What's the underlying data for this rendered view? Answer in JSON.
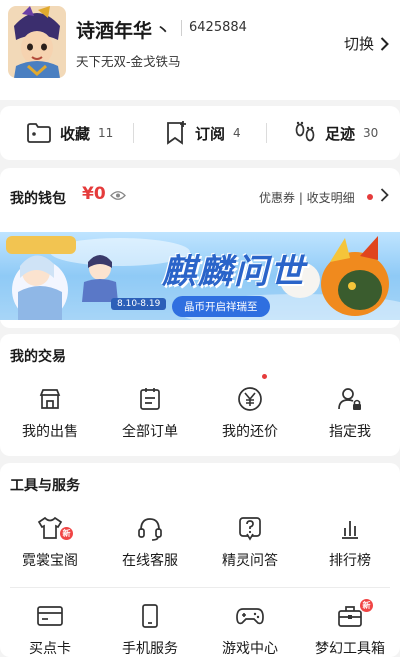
{
  "profile": {
    "nickname": "诗酒年华",
    "nick_suffix": "丶",
    "uid": "6425884",
    "server": "天下无双-金戈铁马",
    "switch_label": "切换"
  },
  "stats": [
    {
      "label": "收藏",
      "count": "11",
      "icon": "folder-icon"
    },
    {
      "label": "订阅",
      "count": "4",
      "icon": "bookmark-add-icon"
    },
    {
      "label": "足迹",
      "count": "30",
      "icon": "footprints-icon"
    }
  ],
  "wallet": {
    "title": "我的钱包",
    "balance": "¥0",
    "links": "优惠券 | 收支明细",
    "banner": {
      "title": "麒麟问世",
      "date_range": "8.10-8.19",
      "subtitle": "晶币开启祥瑞至"
    }
  },
  "trade": {
    "title": "我的交易",
    "items": [
      {
        "label": "我的出售",
        "icon": "shop-icon"
      },
      {
        "label": "全部订单",
        "icon": "order-list-icon"
      },
      {
        "label": "我的还价",
        "icon": "yuan-coin-icon"
      },
      {
        "label": "指定我",
        "icon": "user-lock-icon"
      }
    ]
  },
  "tools": {
    "title": "工具与服务",
    "items": [
      {
        "label": "霓裳宝阁",
        "icon": "tshirt-icon",
        "badge": "新"
      },
      {
        "label": "在线客服",
        "icon": "headset-icon"
      },
      {
        "label": "精灵问答",
        "icon": "question-icon"
      },
      {
        "label": "排行榜",
        "icon": "bar-chart-icon"
      },
      {
        "label": "买点卡",
        "icon": "card-icon"
      },
      {
        "label": "手机服务",
        "icon": "phone-icon"
      },
      {
        "label": "游戏中心",
        "icon": "gamepad-icon"
      },
      {
        "label": "梦幻工具箱",
        "icon": "toolbox-icon",
        "badge": "新"
      }
    ]
  },
  "colors": {
    "accent": "#e53b3b",
    "banner_blue": "#2f6fe0"
  }
}
